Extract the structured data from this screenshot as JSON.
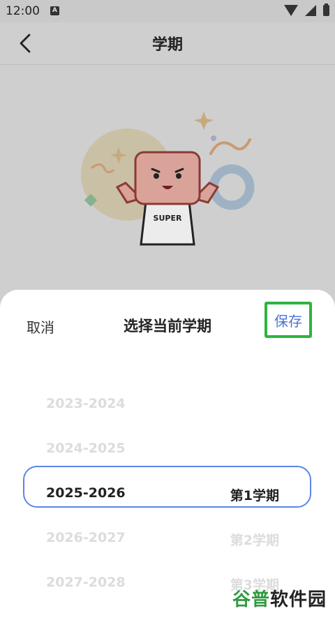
{
  "status_bar": {
    "time": "12:00",
    "indicator": "A"
  },
  "app_bar": {
    "title": "学期"
  },
  "illustration": {
    "shirt_text": "SUPER"
  },
  "sheet": {
    "cancel_label": "取消",
    "title": "选择当前学期",
    "save_label": "保存"
  },
  "picker": {
    "rows": [
      {
        "year": "2023-2024",
        "term": ""
      },
      {
        "year": "2024-2025",
        "term": ""
      },
      {
        "year": "2025-2026",
        "term": "第1学期"
      },
      {
        "year": "2026-2027",
        "term": "第2学期"
      },
      {
        "year": "2027-2028",
        "term": "第3学期"
      }
    ],
    "selected_index": 2
  },
  "watermark": {
    "part1": "谷普",
    "part2": "软件园"
  },
  "colors": {
    "accent": "#4a74d8",
    "highlight": "#2fb344",
    "selection_border": "#5b86e5"
  }
}
